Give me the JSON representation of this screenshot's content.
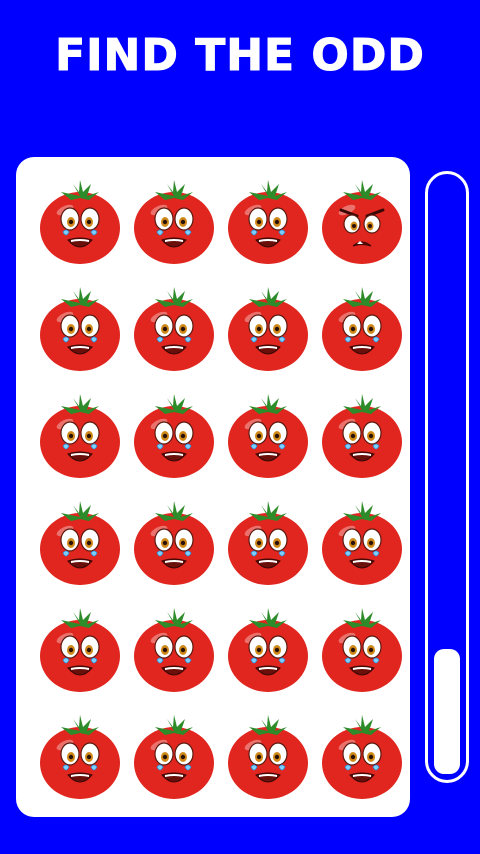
{
  "title": "FIND THE ODD",
  "colors": {
    "background": "#0000ff",
    "board": "#ffffff",
    "tomato": "#e0261e",
    "leaf": "#2e8b2a",
    "timer_fill": "#ffffff"
  },
  "grid": {
    "rows": 6,
    "cols": 4,
    "normal_face": "crying-tomato",
    "odd_face": "angry-tomato",
    "odd_cell": {
      "row": 0,
      "col": 3
    }
  },
  "timer": {
    "remaining_fraction": 0.21
  }
}
